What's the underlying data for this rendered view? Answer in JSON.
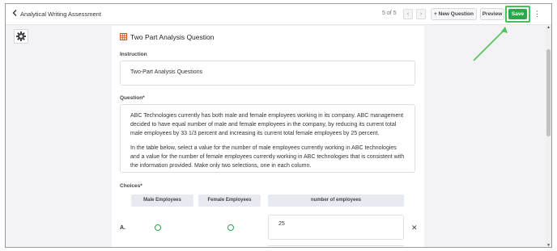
{
  "header": {
    "back_title": "Analytical Writing Assessment",
    "counter": "5 of 5",
    "new_question_label": "New Question",
    "preview_label": "Preview",
    "save_label": "Save",
    "accent_color": "#2aa84a"
  },
  "sidebar": {
    "settings_icon": "gear-icon"
  },
  "question": {
    "type_label": "Two Part Analysis Question",
    "instruction_label": "Instruction",
    "instruction_value": "Two-Part Analysis Questions",
    "question_label": "Question*",
    "paragraph_1": "ABC Technologies currently has both male and female employees working in its company. ABC management decided to have equal number of male and female employees in the company, by reducing its current total male employees by 33 1/3 percent and increasing its current total female employees by 25 percent.",
    "paragraph_2": "In the table below, select a value for the number of male employees currently working in ABC technologies and a value for the number of female employees currently working in ABC technologies that is consistent with the information provided. Make only two selections, one in each column."
  },
  "choices": {
    "label": "Choices*",
    "columns": [
      "Male Employees",
      "Female Employees",
      "number of employees"
    ],
    "rows": [
      {
        "letter": "A.",
        "value": "25"
      }
    ]
  }
}
